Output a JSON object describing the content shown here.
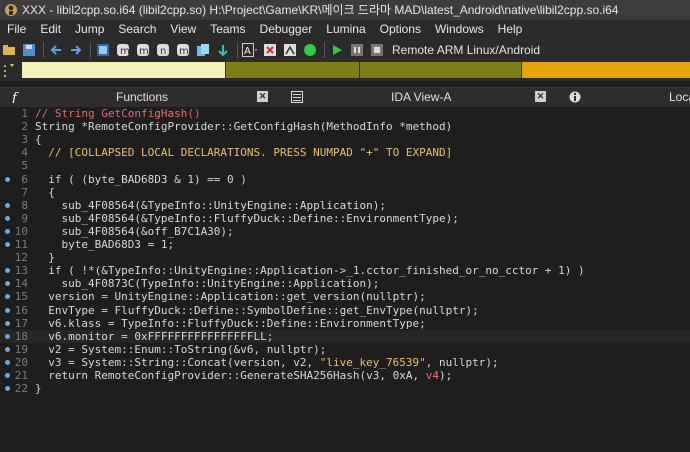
{
  "window": {
    "title": "XXX - libil2cpp.so.i64 (libil2cpp.so) H:\\Project\\Game\\KR\\메이크 드라마 MAD\\latest_Android\\native\\libil2cpp.so.i64"
  },
  "menu": [
    "File",
    "Edit",
    "Jump",
    "Search",
    "View",
    "Teams",
    "Debugger",
    "Lumina",
    "Options",
    "Windows",
    "Help"
  ],
  "toolbar": {
    "debugger_label": "Remote ARM Linux/Android",
    "icons": [
      "save-icon",
      "open-icon",
      "back-icon",
      "forward-icon",
      "tool-icon",
      "tool-icon",
      "tool-icon",
      "tool-icon",
      "tool-icon",
      "jump-icon",
      "text-icon",
      "tool-icon",
      "tool-icon",
      "go-icon",
      "play-icon",
      "pause-icon",
      "stop-icon"
    ]
  },
  "navbar": {
    "segments": [
      {
        "color": "#f5f2b8",
        "weight": 29
      },
      {
        "color": "#7e7e12",
        "weight": 19
      },
      {
        "color": "#7e7e12",
        "weight": 23
      },
      {
        "color": "#e6a400",
        "weight": 24
      }
    ]
  },
  "tabs": [
    {
      "label": "Functions",
      "closable": true
    },
    {
      "label": "IDA View-A",
      "closable": true
    },
    {
      "label": "Loca",
      "closable": false
    }
  ],
  "code": {
    "lines": [
      {
        "n": "1",
        "dot": false,
        "text": "// String GetConfigHash()",
        "style": "comment"
      },
      {
        "n": "2",
        "dot": false,
        "text": "String *RemoteConfigProvider::GetConfigHash(MethodInfo *method)",
        "style": ""
      },
      {
        "n": "3",
        "dot": false,
        "text": "{",
        "style": ""
      },
      {
        "n": "4",
        "dot": false,
        "text": "  // [COLLAPSED LOCAL DECLARATIONS. PRESS NUMPAD \"+\" TO EXPAND]",
        "style": "collapsed"
      },
      {
        "n": "5",
        "dot": false,
        "text": "",
        "style": ""
      },
      {
        "n": "6",
        "dot": true,
        "text": "  if ( (byte_BAD68D3 & 1) == 0 )",
        "style": ""
      },
      {
        "n": "7",
        "dot": false,
        "text": "  {",
        "style": ""
      },
      {
        "n": "8",
        "dot": true,
        "text": "    sub_4F08564(&TypeInfo::UnityEngine::Application);",
        "style": ""
      },
      {
        "n": "9",
        "dot": true,
        "text": "    sub_4F08564(&TypeInfo::FluffyDuck::Define::EnvironmentType);",
        "style": ""
      },
      {
        "n": "10",
        "dot": true,
        "text": "    sub_4F08564(&off_B7C1A30);",
        "style": ""
      },
      {
        "n": "11",
        "dot": true,
        "text": "    byte_BAD68D3 = 1;",
        "style": ""
      },
      {
        "n": "12",
        "dot": false,
        "text": "  }",
        "style": ""
      },
      {
        "n": "13",
        "dot": true,
        "text": "  if ( !*(&TypeInfo::UnityEngine::Application->_1.cctor_finished_or_no_cctor + 1) )",
        "style": ""
      },
      {
        "n": "14",
        "dot": true,
        "text": "    sub_4F0873C(TypeInfo::UnityEngine::Application);",
        "style": ""
      },
      {
        "n": "15",
        "dot": true,
        "text": "  version = UnityEngine::Application::get_version(nullptr);",
        "style": ""
      },
      {
        "n": "16",
        "dot": true,
        "text": "  EnvType = FluffyDuck::Define::SymbolDefine::get_EnvType(nullptr);",
        "style": ""
      },
      {
        "n": "17",
        "dot": true,
        "text": "  v6.klass = TypeInfo::FluffyDuck::Define::EnvironmentType;",
        "style": ""
      },
      {
        "n": "18",
        "dot": true,
        "text": "  v6.monitor = 0xFFFFFFFFFFFFFFFFLL;",
        "style": "",
        "hl": true
      },
      {
        "n": "19",
        "dot": true,
        "text": "  v2 = System::Enum::ToString(&v6, nullptr);",
        "style": ""
      },
      {
        "n": "20",
        "dot": true,
        "text": "  v3 = System::String::Concat(version, v2, ",
        "style": "",
        "tail_string": "\"live_key_76539\"",
        "tail": ", nullptr);"
      },
      {
        "n": "21",
        "dot": true,
        "text": "  return RemoteConfigProvider::GenerateSHA256Hash(v3, 0xA, ",
        "style": "",
        "tail_red": "v4",
        "tail": ");"
      },
      {
        "n": "22",
        "dot": true,
        "text": "}",
        "style": ""
      }
    ]
  }
}
